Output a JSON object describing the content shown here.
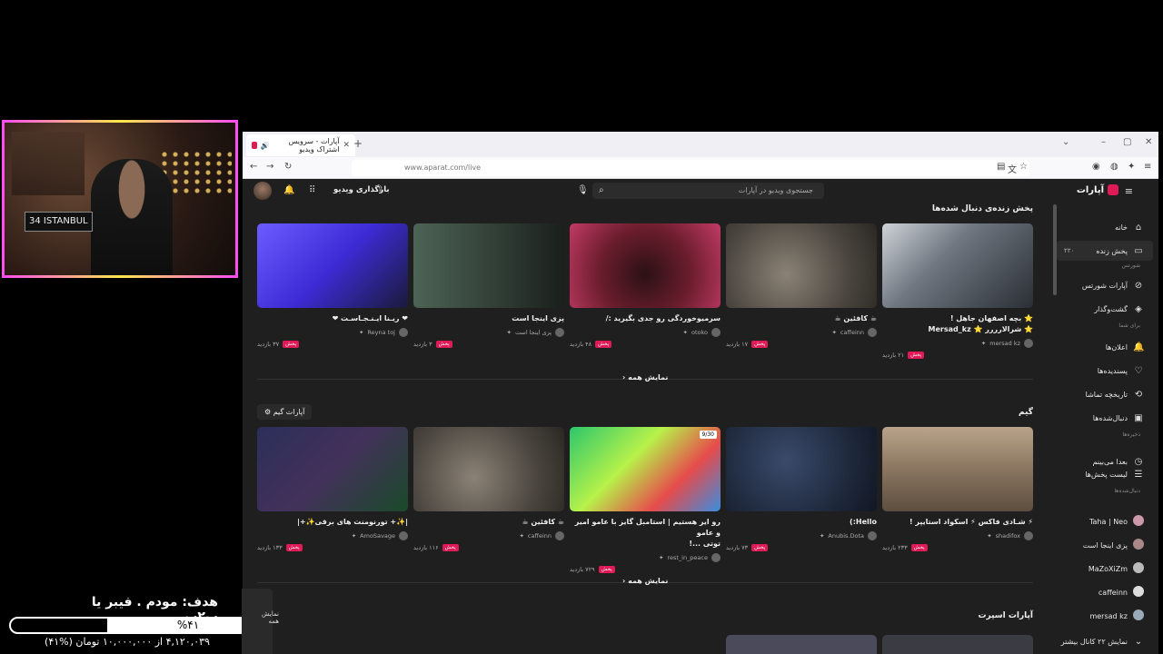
{
  "overlay": {
    "goal_title": "هدف: مودم . فیبر یا پ۲پ",
    "goal_percent_label": "%۴۱",
    "goal_fraction": 0.41,
    "goal_subtitle": "۴,۱۲۰,۰۳۹ از ۱۰,۰۰۰,۰۰۰ تومان (%۴۱)",
    "webcam_plate": "34 ISTANBUL"
  },
  "browser": {
    "tab_title": "آپارات - سرویس اشتراک ویدیو",
    "url": "www.aparat.com/live"
  },
  "site": {
    "logo": "آپارات",
    "search_placeholder": "جستجوی ویدیو در آپارات",
    "upload_label": "بارگذاری ویدیو"
  },
  "sidebar": {
    "items": [
      {
        "label": "خانه",
        "icon": "⌂"
      },
      {
        "label": "پخش زنده",
        "icon": "▭",
        "count": "۲۲۰"
      },
      {
        "section": "شورتس"
      },
      {
        "label": "آپارات شورتس",
        "icon": "⊘"
      },
      {
        "label": "گشت‌وگذار",
        "icon": "◈"
      },
      {
        "section": "برای شما"
      },
      {
        "label": "اعلان‌ها",
        "icon": "🔔"
      },
      {
        "label": "پسندیده‌ها",
        "icon": "♡"
      },
      {
        "label": "تاریخچه تماشا",
        "icon": "⟲"
      },
      {
        "label": "دنبال‌شده‌ها",
        "icon": "▣"
      },
      {
        "section": "ذخیره‌ها"
      },
      {
        "label": "بعدا می‌بینم",
        "icon": "◷"
      },
      {
        "label": "لیست پخش‌ها",
        "icon": "☰"
      },
      {
        "section": "دنبال‌شده‌ها"
      },
      {
        "label": "Taha | Neo"
      },
      {
        "label": "پزی اینجا است"
      },
      {
        "label": "MaZoXiZm"
      },
      {
        "label": "caffeinn"
      },
      {
        "label": "mersad kz"
      },
      {
        "label": "نمایش ۲۲ کانال بیشتر",
        "icon": "⌄"
      }
    ]
  },
  "sections": {
    "followed_live": "پخش زنده‌ی دنبال شده‌ها",
    "game": "گیم",
    "aparat_game_chip": "آپارات گیم",
    "esport": "آپارات اسپرت",
    "show_all": "نمایش همه"
  },
  "row1": [
    {
      "title1": "⭐ بچه اصفهان جاهل !",
      "title2": "⭐ شرالارررر ⭐ Mersad_kz",
      "channel": "mersad kz",
      "viewers": "۲۱ بازدید",
      "live": "پخش"
    },
    {
      "title1": "☕ کافئین ☕",
      "channel": "caffeinn",
      "viewers": "۱۷ بازدید",
      "live": "پخش"
    },
    {
      "title1": "سرمیوخوردگی رو جدی بگیرید :/",
      "channel": "otoko",
      "viewers": "۴۸ بازدید",
      "live": "پخش"
    },
    {
      "title1": "پزی اینجا است",
      "channel": "پزی اینجا است",
      "viewers": "۳ بازدید",
      "live": "پخش"
    },
    {
      "title1": "❤ ریـنا ایـنـجـاسـت ❤",
      "channel": "Reyna toj",
      "viewers": "۳۷ بازدید",
      "live": "پخش"
    }
  ],
  "row2": [
    {
      "title1": "⚡ شـادی فاکس ⚡ اسکواد استایپر !",
      "channel": "shadifox",
      "viewers": "۲۳۳ بازدید",
      "live": "پخش"
    },
    {
      "title1": "Hello:)",
      "channel": "Anubis.Dota",
      "viewers": "۷۳ بازدید",
      "live": "پخش"
    },
    {
      "title1": "رو ایر هستیم | استامبل گایز با عامو امیر و عامو",
      "title2": "توتی ...!",
      "channel": "rest_in_peace",
      "viewers": "۷۲۹ بازدید",
      "live": "پخش"
    },
    {
      "title1": "☕ کافئین ☕",
      "channel": "caffeinn",
      "viewers": "۱۱۶ بازدید",
      "live": "پخش"
    },
    {
      "title1": "|✨+ تورنومنت های برقی✨+|",
      "channel": "AmoSavage",
      "viewers": "۱۳۳ بازدید",
      "live": "پخش"
    }
  ],
  "thumb_badge": "9/30"
}
